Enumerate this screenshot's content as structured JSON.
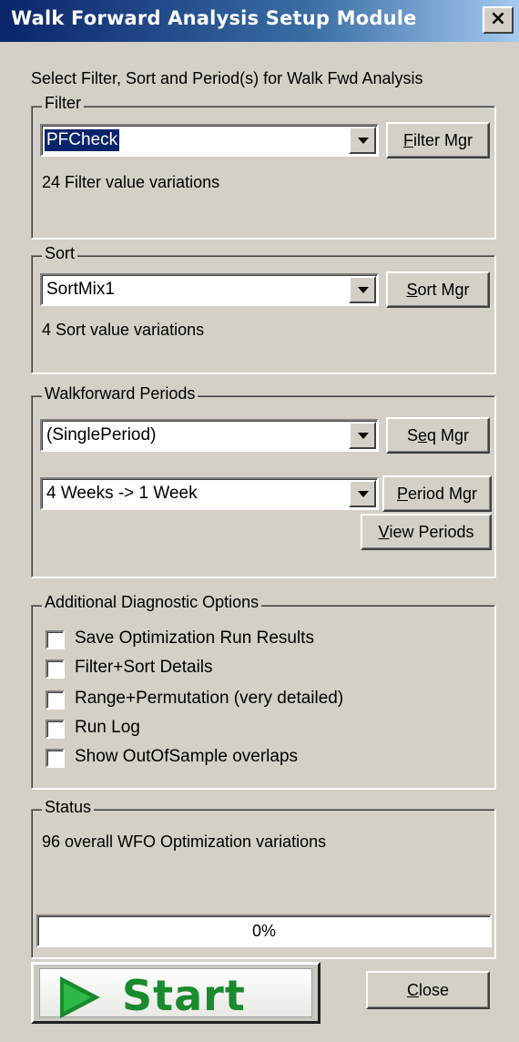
{
  "window": {
    "title": "Walk Forward Analysis Setup Module",
    "close_glyph": "×",
    "subtitle": "Select Filter, Sort and Period(s) for Walk Fwd Analysis"
  },
  "filter": {
    "legend": "Filter",
    "selected": "PFCheck",
    "manager_btn_prefix": "",
    "manager_btn_access": "F",
    "manager_btn_rest": "ilter Mgr",
    "info": "24 Filter value variations"
  },
  "sort": {
    "legend": "Sort",
    "selected": "SortMix1",
    "manager_btn_access": "S",
    "manager_btn_rest": "ort Mgr",
    "info": "4 Sort value variations"
  },
  "periods": {
    "legend": "Walkforward Periods",
    "sequence_selected": "(SinglePeriod)",
    "seq_btn_pre": "S",
    "seq_btn_access": "e",
    "seq_btn_rest": "q Mgr",
    "period_selected": "4 Weeks -> 1 Week",
    "period_btn_access": "P",
    "period_btn_rest": "eriod Mgr",
    "view_btn_access": "V",
    "view_btn_rest": "iew Periods"
  },
  "diagnostics": {
    "legend": "Additional Diagnostic Options",
    "options": [
      {
        "label": "Save Optimization Run Results",
        "checked": false
      },
      {
        "label": "Filter+Sort Details",
        "checked": false
      },
      {
        "label": "Range+Permutation (very detailed)",
        "checked": false
      },
      {
        "label": "Run Log",
        "checked": false
      },
      {
        "label": "Show OutOfSample overlaps",
        "checked": false
      }
    ]
  },
  "status": {
    "legend": "Status",
    "message": "96 overall WFO Optimization variations",
    "progress_text": "0%",
    "progress_value": 0
  },
  "actions": {
    "start_label": "Start",
    "close_access": "C",
    "close_rest": "lose"
  },
  "colors": {
    "title_bar": "#0a246a",
    "face": "#d4d0c8",
    "selection": "#0a246a",
    "start_green": "#1a8a2e"
  }
}
